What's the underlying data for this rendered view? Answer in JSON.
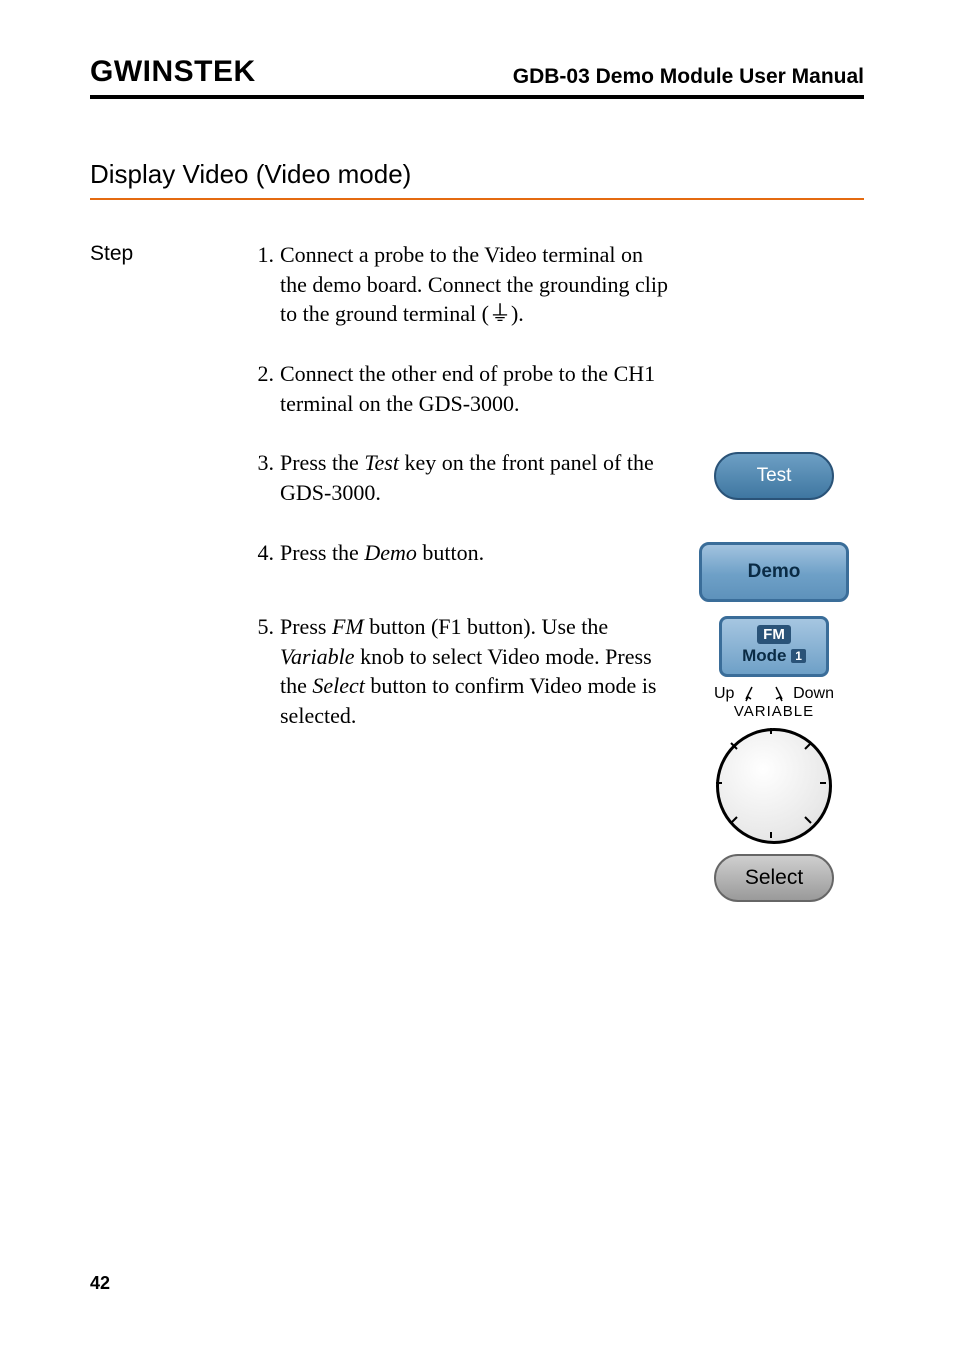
{
  "header": {
    "brand": "GWINSTEK",
    "doc_title": "GDB-03 Demo Module User Manual"
  },
  "section_title": "Display Video (Video mode)",
  "step_label": "Step",
  "steps": [
    {
      "num": "1.",
      "text_parts": [
        "Connect a probe to the Video terminal on the demo board. Connect the grounding clip to the ground terminal (",
        ")."
      ],
      "ground_symbol": "⏚"
    },
    {
      "num": "2.",
      "text": "Connect the other end of probe to the CH1 terminal on the GDS-3000."
    },
    {
      "num": "3.",
      "text_parts": [
        "Press the ",
        " key on the front panel of the GDS-3000."
      ],
      "em": "Test",
      "button": {
        "label": "Test",
        "kind": "test"
      }
    },
    {
      "num": "4.",
      "text_parts": [
        "Press the ",
        " button."
      ],
      "em": "Demo",
      "button": {
        "label": "Demo",
        "kind": "demo"
      }
    },
    {
      "num": "5.",
      "text_parts": [
        "Press ",
        " button (F1 button). Use the ",
        " knob to select Video mode. Press the ",
        " button to confirm Video mode is selected."
      ],
      "ems": [
        "FM",
        "Variable",
        "Select"
      ],
      "fm": {
        "badge": "FM",
        "mode_text": "Mode",
        "mode_num": "1"
      },
      "variable": {
        "up": "Up",
        "down": "Down",
        "label": "VARIABLE"
      },
      "select_label": "Select"
    }
  ],
  "page_number": "42"
}
